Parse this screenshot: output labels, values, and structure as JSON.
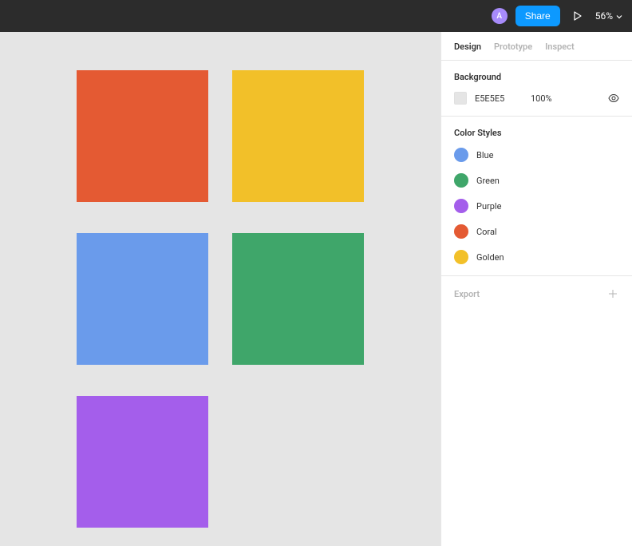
{
  "topbar": {
    "avatar_initial": "A",
    "share_label": "Share",
    "zoom_label": "56%"
  },
  "tabs": {
    "design": "Design",
    "prototype": "Prototype",
    "inspect": "Inspect"
  },
  "background": {
    "title": "Background",
    "hex": "E5E5E5",
    "opacity": "100%"
  },
  "color_styles": {
    "title": "Color Styles",
    "items": [
      {
        "label": "Blue",
        "color": "#6a9beb",
        "key": "blue"
      },
      {
        "label": "Green",
        "color": "#3fa66a",
        "key": "green"
      },
      {
        "label": "Purple",
        "color": "#a45eeb",
        "key": "purple"
      },
      {
        "label": "Coral",
        "color": "#e45a33",
        "key": "coral"
      },
      {
        "label": "Golden",
        "color": "#f2c029",
        "key": "golden"
      }
    ]
  },
  "export": {
    "title": "Export"
  },
  "canvas": {
    "bg": "#e5e5e5",
    "rects": [
      {
        "key": "coral",
        "color": "#e45a33"
      },
      {
        "key": "golden",
        "color": "#f2c029"
      },
      {
        "key": "blue",
        "color": "#6a9beb"
      },
      {
        "key": "green",
        "color": "#3fa66a"
      },
      {
        "key": "purple",
        "color": "#a45eeb"
      }
    ]
  }
}
